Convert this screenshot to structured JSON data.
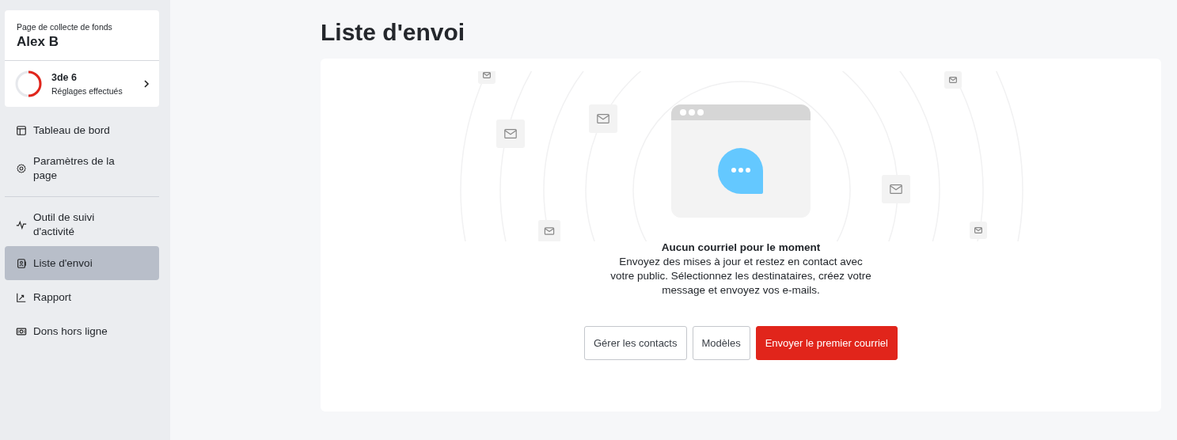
{
  "sidebar": {
    "page_label": "Page de collecte de fonds",
    "page_name": "Alex B",
    "progress": {
      "count": "3de 6",
      "caption": "Réglages effectués",
      "level": 0.5
    },
    "nav_groups": [
      [
        {
          "label": "Tableau de bord",
          "selected": false
        },
        {
          "label": "Paramètres de la page",
          "selected": false
        }
      ],
      [
        {
          "label": "Outil de suivi d'activité",
          "selected": false
        },
        {
          "label": "Liste d'envoi",
          "selected": true
        },
        {
          "label": "Rapport",
          "selected": false
        },
        {
          "label": "Dons hors ligne",
          "selected": false
        }
      ]
    ]
  },
  "main": {
    "title": "Liste d'envoi",
    "empty_state": {
      "heading": "Aucun courriel pour le moment",
      "text": "Envoyez des mises à jour et restez en contact avec votre public. Sélectionnez les destinataires, créez votre message et envoyez vos e-mails."
    },
    "buttons": [
      {
        "label": "Gérer les contacts",
        "kind": "secondary"
      },
      {
        "label": "Modèles",
        "kind": "secondary"
      },
      {
        "label": "Envoyer le premier courriel",
        "kind": "primary"
      }
    ]
  }
}
